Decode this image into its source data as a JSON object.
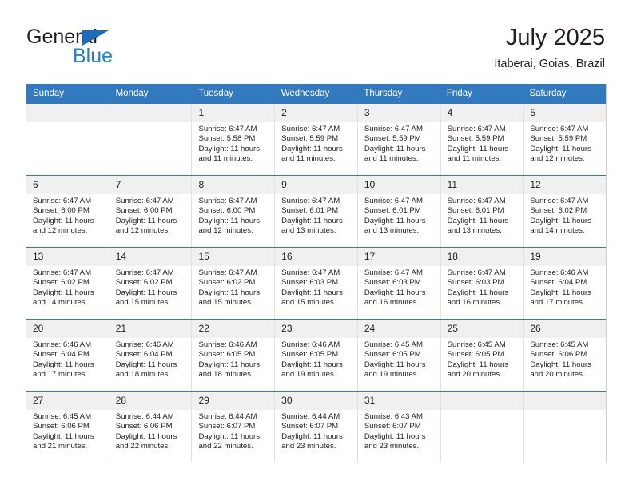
{
  "brand": {
    "name_top": "General",
    "name_bottom": "Blue",
    "colors": {
      "top_text": "#231f20",
      "bottom_text": "#2283c6",
      "triangle": "#1e6cb5"
    }
  },
  "header": {
    "title": "July 2025",
    "location": "Itaberai, Goias, Brazil"
  },
  "theme": {
    "header_blue": "#3379bd",
    "day_band": "#f0f0f0",
    "cell_border": "#e2e2e2",
    "text": "#231f20"
  },
  "calendar": {
    "weekdays": [
      "Sunday",
      "Monday",
      "Tuesday",
      "Wednesday",
      "Thursday",
      "Friday",
      "Saturday"
    ],
    "labels": {
      "sunrise_prefix": "Sunrise:",
      "sunset_prefix": "Sunset:",
      "daylight_prefix": "Daylight:"
    },
    "weeks": [
      [
        {
          "day": "",
          "empty": true
        },
        {
          "day": "",
          "empty": true
        },
        {
          "day": "1",
          "sunrise": "Sunrise: 6:47 AM",
          "sunset": "Sunset: 5:58 PM",
          "daylight": "Daylight: 11 hours and 11 minutes."
        },
        {
          "day": "2",
          "sunrise": "Sunrise: 6:47 AM",
          "sunset": "Sunset: 5:59 PM",
          "daylight": "Daylight: 11 hours and 11 minutes."
        },
        {
          "day": "3",
          "sunrise": "Sunrise: 6:47 AM",
          "sunset": "Sunset: 5:59 PM",
          "daylight": "Daylight: 11 hours and 11 minutes."
        },
        {
          "day": "4",
          "sunrise": "Sunrise: 6:47 AM",
          "sunset": "Sunset: 5:59 PM",
          "daylight": "Daylight: 11 hours and 11 minutes."
        },
        {
          "day": "5",
          "sunrise": "Sunrise: 6:47 AM",
          "sunset": "Sunset: 5:59 PM",
          "daylight": "Daylight: 11 hours and 12 minutes."
        }
      ],
      [
        {
          "day": "6",
          "sunrise": "Sunrise: 6:47 AM",
          "sunset": "Sunset: 6:00 PM",
          "daylight": "Daylight: 11 hours and 12 minutes."
        },
        {
          "day": "7",
          "sunrise": "Sunrise: 6:47 AM",
          "sunset": "Sunset: 6:00 PM",
          "daylight": "Daylight: 11 hours and 12 minutes."
        },
        {
          "day": "8",
          "sunrise": "Sunrise: 6:47 AM",
          "sunset": "Sunset: 6:00 PM",
          "daylight": "Daylight: 11 hours and 12 minutes."
        },
        {
          "day": "9",
          "sunrise": "Sunrise: 6:47 AM",
          "sunset": "Sunset: 6:01 PM",
          "daylight": "Daylight: 11 hours and 13 minutes."
        },
        {
          "day": "10",
          "sunrise": "Sunrise: 6:47 AM",
          "sunset": "Sunset: 6:01 PM",
          "daylight": "Daylight: 11 hours and 13 minutes."
        },
        {
          "day": "11",
          "sunrise": "Sunrise: 6:47 AM",
          "sunset": "Sunset: 6:01 PM",
          "daylight": "Daylight: 11 hours and 13 minutes."
        },
        {
          "day": "12",
          "sunrise": "Sunrise: 6:47 AM",
          "sunset": "Sunset: 6:02 PM",
          "daylight": "Daylight: 11 hours and 14 minutes."
        }
      ],
      [
        {
          "day": "13",
          "sunrise": "Sunrise: 6:47 AM",
          "sunset": "Sunset: 6:02 PM",
          "daylight": "Daylight: 11 hours and 14 minutes."
        },
        {
          "day": "14",
          "sunrise": "Sunrise: 6:47 AM",
          "sunset": "Sunset: 6:02 PM",
          "daylight": "Daylight: 11 hours and 15 minutes."
        },
        {
          "day": "15",
          "sunrise": "Sunrise: 6:47 AM",
          "sunset": "Sunset: 6:02 PM",
          "daylight": "Daylight: 11 hours and 15 minutes."
        },
        {
          "day": "16",
          "sunrise": "Sunrise: 6:47 AM",
          "sunset": "Sunset: 6:03 PM",
          "daylight": "Daylight: 11 hours and 15 minutes."
        },
        {
          "day": "17",
          "sunrise": "Sunrise: 6:47 AM",
          "sunset": "Sunset: 6:03 PM",
          "daylight": "Daylight: 11 hours and 16 minutes."
        },
        {
          "day": "18",
          "sunrise": "Sunrise: 6:47 AM",
          "sunset": "Sunset: 6:03 PM",
          "daylight": "Daylight: 11 hours and 16 minutes."
        },
        {
          "day": "19",
          "sunrise": "Sunrise: 6:46 AM",
          "sunset": "Sunset: 6:04 PM",
          "daylight": "Daylight: 11 hours and 17 minutes."
        }
      ],
      [
        {
          "day": "20",
          "sunrise": "Sunrise: 6:46 AM",
          "sunset": "Sunset: 6:04 PM",
          "daylight": "Daylight: 11 hours and 17 minutes."
        },
        {
          "day": "21",
          "sunrise": "Sunrise: 6:46 AM",
          "sunset": "Sunset: 6:04 PM",
          "daylight": "Daylight: 11 hours and 18 minutes."
        },
        {
          "day": "22",
          "sunrise": "Sunrise: 6:46 AM",
          "sunset": "Sunset: 6:05 PM",
          "daylight": "Daylight: 11 hours and 18 minutes."
        },
        {
          "day": "23",
          "sunrise": "Sunrise: 6:46 AM",
          "sunset": "Sunset: 6:05 PM",
          "daylight": "Daylight: 11 hours and 19 minutes."
        },
        {
          "day": "24",
          "sunrise": "Sunrise: 6:45 AM",
          "sunset": "Sunset: 6:05 PM",
          "daylight": "Daylight: 11 hours and 19 minutes."
        },
        {
          "day": "25",
          "sunrise": "Sunrise: 6:45 AM",
          "sunset": "Sunset: 6:05 PM",
          "daylight": "Daylight: 11 hours and 20 minutes."
        },
        {
          "day": "26",
          "sunrise": "Sunrise: 6:45 AM",
          "sunset": "Sunset: 6:06 PM",
          "daylight": "Daylight: 11 hours and 20 minutes."
        }
      ],
      [
        {
          "day": "27",
          "sunrise": "Sunrise: 6:45 AM",
          "sunset": "Sunset: 6:06 PM",
          "daylight": "Daylight: 11 hours and 21 minutes."
        },
        {
          "day": "28",
          "sunrise": "Sunrise: 6:44 AM",
          "sunset": "Sunset: 6:06 PM",
          "daylight": "Daylight: 11 hours and 22 minutes."
        },
        {
          "day": "29",
          "sunrise": "Sunrise: 6:44 AM",
          "sunset": "Sunset: 6:07 PM",
          "daylight": "Daylight: 11 hours and 22 minutes."
        },
        {
          "day": "30",
          "sunrise": "Sunrise: 6:44 AM",
          "sunset": "Sunset: 6:07 PM",
          "daylight": "Daylight: 11 hours and 23 minutes."
        },
        {
          "day": "31",
          "sunrise": "Sunrise: 6:43 AM",
          "sunset": "Sunset: 6:07 PM",
          "daylight": "Daylight: 11 hours and 23 minutes."
        },
        {
          "day": "",
          "empty": true
        },
        {
          "day": "",
          "empty": true
        }
      ]
    ]
  }
}
